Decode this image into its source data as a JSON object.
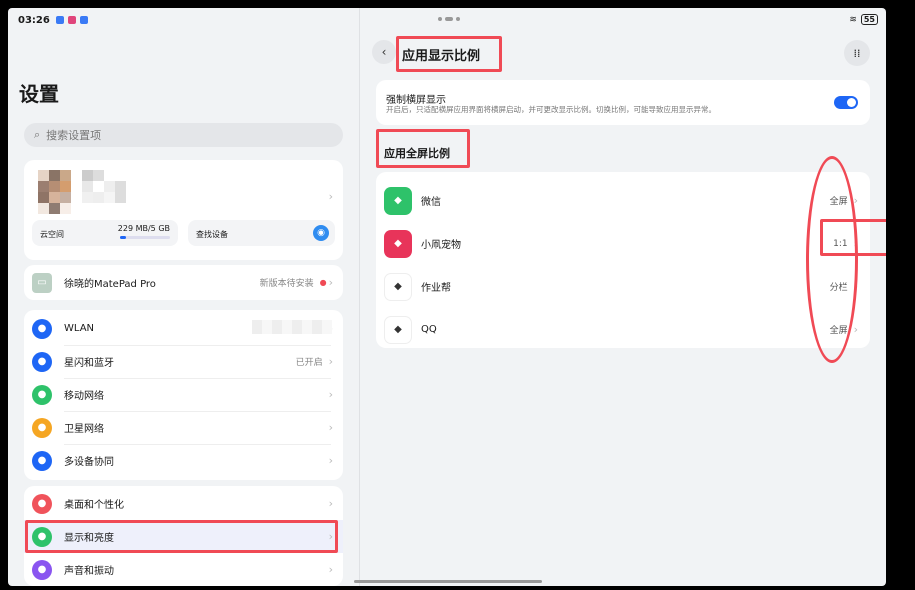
{
  "status": {
    "time": "03:26",
    "battery": "55"
  },
  "left": {
    "title": "设置",
    "search_placeholder": "搜索设置项",
    "cloud": {
      "label": "云空间",
      "usage": "229 MB/5 GB",
      "progress": 0.045
    },
    "find_device": "查找设备",
    "device": {
      "name": "徐晓的MatePad Pro",
      "status": "新版本待安装"
    },
    "group1": [
      {
        "label": "WLAN",
        "value": "",
        "icon": "wifi-icon",
        "color": "#1e66f5"
      },
      {
        "label": "星闪和蓝牙",
        "value": "已开启",
        "icon": "bluetooth-icon",
        "color": "#1e66f5"
      },
      {
        "label": "移动网络",
        "value": "",
        "icon": "mobile-network-icon",
        "color": "#2ec26a"
      },
      {
        "label": "卫星网络",
        "value": "",
        "icon": "satellite-icon",
        "color": "#f5a623"
      },
      {
        "label": "多设备协同",
        "value": "",
        "icon": "multi-device-icon",
        "color": "#1e66f5"
      }
    ],
    "group2": [
      {
        "label": "桌面和个性化",
        "icon": "desktop-icon",
        "color": "#f0535b"
      },
      {
        "label": "显示和亮度",
        "icon": "display-icon",
        "color": "#2ec26a"
      },
      {
        "label": "声音和振动",
        "icon": "sound-icon",
        "color": "#8a55f0"
      }
    ]
  },
  "right": {
    "title": "应用显示比例",
    "force_landscape": {
      "title": "强制横屏显示",
      "desc": "开启后，只适配横屏应用界面将横屏启动，并可更改显示比例。切换比例，可能导致应用显示异常。",
      "enabled": true
    },
    "section_title": "应用全屏比例",
    "apps": [
      {
        "name": "微信",
        "ratio": "全屏",
        "icon": "wechat-icon",
        "color": "#2ec26a"
      },
      {
        "name": "小凧宠物",
        "ratio": "1:1",
        "icon": "pet-app-icon",
        "color": "#e8345a"
      },
      {
        "name": "作业帮",
        "ratio": "分栏",
        "icon": "homework-icon",
        "color": "#ffffff"
      },
      {
        "name": "QQ",
        "ratio": "全屏",
        "icon": "qq-icon",
        "color": "#ffffff"
      }
    ]
  }
}
